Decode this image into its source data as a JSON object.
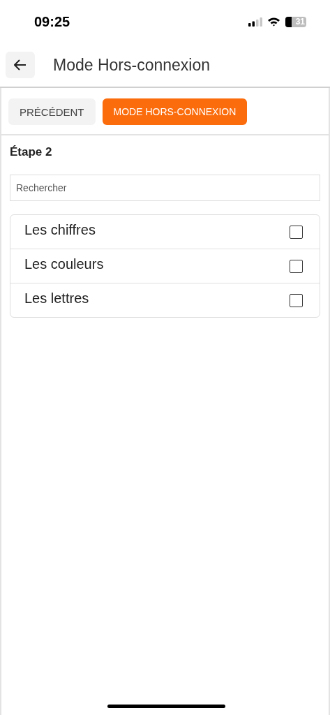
{
  "status_bar": {
    "time": "09:25",
    "battery": "31"
  },
  "header": {
    "title": "Mode Hors-connexion"
  },
  "buttons": [
    {
      "label": "PRÉCÉDENT",
      "kind": "secondary"
    },
    {
      "label": "MODE HORS-CONNEXION",
      "kind": "primary"
    }
  ],
  "step_title": "Étape 2",
  "search": {
    "placeholder": "Rechercher"
  },
  "items": [
    {
      "label": "Les chiffres",
      "checked": false
    },
    {
      "label": "Les couleurs",
      "checked": false
    },
    {
      "label": "Les lettres",
      "checked": false
    }
  ]
}
